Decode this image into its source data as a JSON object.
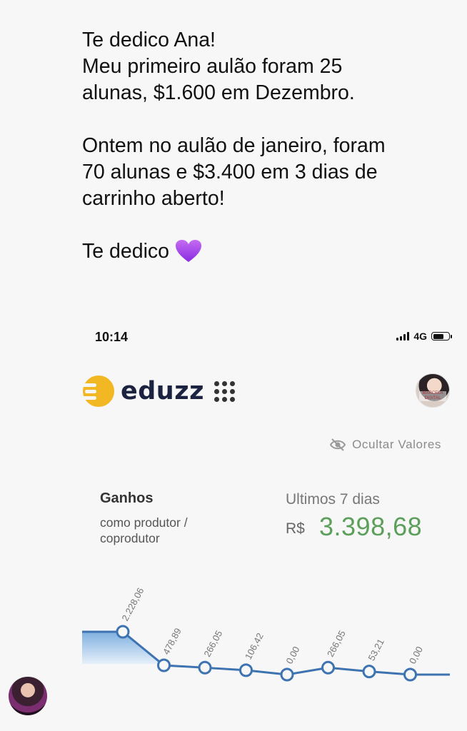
{
  "message": {
    "line1": "Te dedico Ana!",
    "line2": "Meu primeiro aulão foram 25",
    "line3": "alunas, $1.600 em Dezembro.",
    "line4": "Ontem no aulão de janeiro, foram",
    "line5": "70 alunas e $3.400 em 3 dias de",
    "line6": "carrinho aberto!",
    "line7": "Te dedico",
    "emoji_icon": "purple-heart-icon"
  },
  "status_bar": {
    "time": "10:14",
    "network": "4G"
  },
  "app": {
    "brand": "eduzz",
    "hide_values": "Ocultar Valores",
    "avatar_caption": "MARCELA DIGITAL"
  },
  "earnings": {
    "title": "Ganhos",
    "subtitle": "como produtor / coprodutor",
    "period": "Ultimos 7 dias",
    "currency": "R$",
    "amount": "3.398,68"
  },
  "colors": {
    "amount": "#5b9f5a",
    "line": "#3d73b0",
    "brand_yellow": "#f2b824",
    "brand_navy": "#1b2340"
  },
  "chart_data": {
    "type": "line",
    "labels": [
      "2.228,06",
      "478,89",
      "266,05",
      "106,42",
      "0,00",
      "266,05",
      "53,21",
      "0,00"
    ],
    "values": [
      2228.06,
      478.89,
      266.05,
      106.42,
      0.0,
      266.05,
      53.21,
      0.0
    ]
  }
}
